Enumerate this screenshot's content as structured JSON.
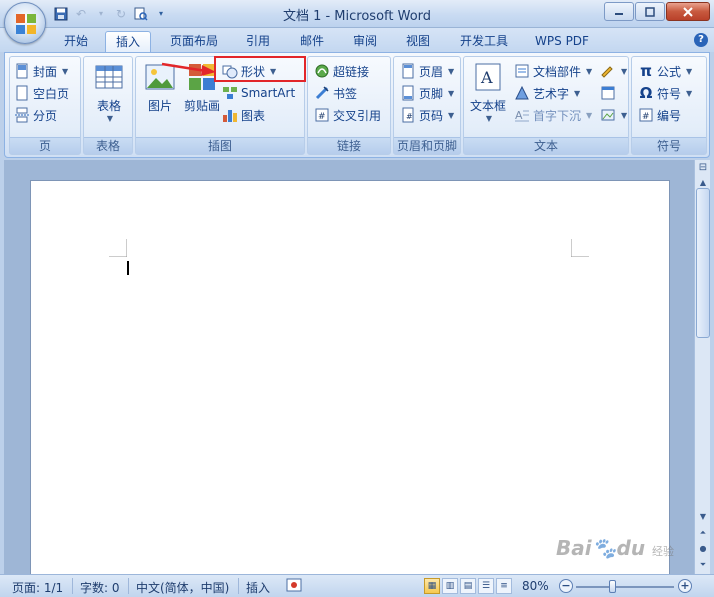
{
  "window": {
    "title": "文档 1 - Microsoft Word"
  },
  "qat": {
    "save_icon": "save-icon",
    "undo_icon": "undo-icon",
    "redo_icon": "redo-icon",
    "preview_icon": "print-preview-icon"
  },
  "tabs": [
    {
      "label": "开始"
    },
    {
      "label": "插入"
    },
    {
      "label": "页面布局"
    },
    {
      "label": "引用"
    },
    {
      "label": "邮件"
    },
    {
      "label": "审阅"
    },
    {
      "label": "视图"
    },
    {
      "label": "开发工具"
    },
    {
      "label": "WPS PDF"
    }
  ],
  "active_tab": "插入",
  "ribbon": {
    "pages": {
      "label": "页",
      "cover": "封面",
      "blank": "空白页",
      "break": "分页"
    },
    "table": {
      "label": "表格",
      "button": "表格"
    },
    "illustrations": {
      "label": "插图",
      "picture": "图片",
      "clipart": "剪贴画",
      "shapes": "形状",
      "smartart": "SmartArt",
      "chart": "图表"
    },
    "links": {
      "label": "链接",
      "hyperlink": "超链接",
      "bookmark": "书签",
      "crossref": "交叉引用"
    },
    "headerfooter": {
      "label": "页眉和页脚",
      "header": "页眉",
      "footer": "页脚",
      "pagenum": "页码"
    },
    "text": {
      "label": "文本",
      "textbox": "文本框",
      "quickparts": "文档部件",
      "wordart": "艺术字",
      "dropcap": "首字下沉"
    },
    "symbols": {
      "label": "符号",
      "equation": "公式",
      "symbol": "符号",
      "number": "编号"
    }
  },
  "status": {
    "page": "页面: 1/1",
    "words": "字数: 0",
    "language": "中文(简体，中国)",
    "mode": "插入",
    "zoom": "80%",
    "zoom_level": 0.8
  },
  "watermark": {
    "brand": "Bai",
    "du": "du",
    "sub": "经验"
  },
  "colors": {
    "accent": "#15428b",
    "highlight": "#e2262a"
  }
}
